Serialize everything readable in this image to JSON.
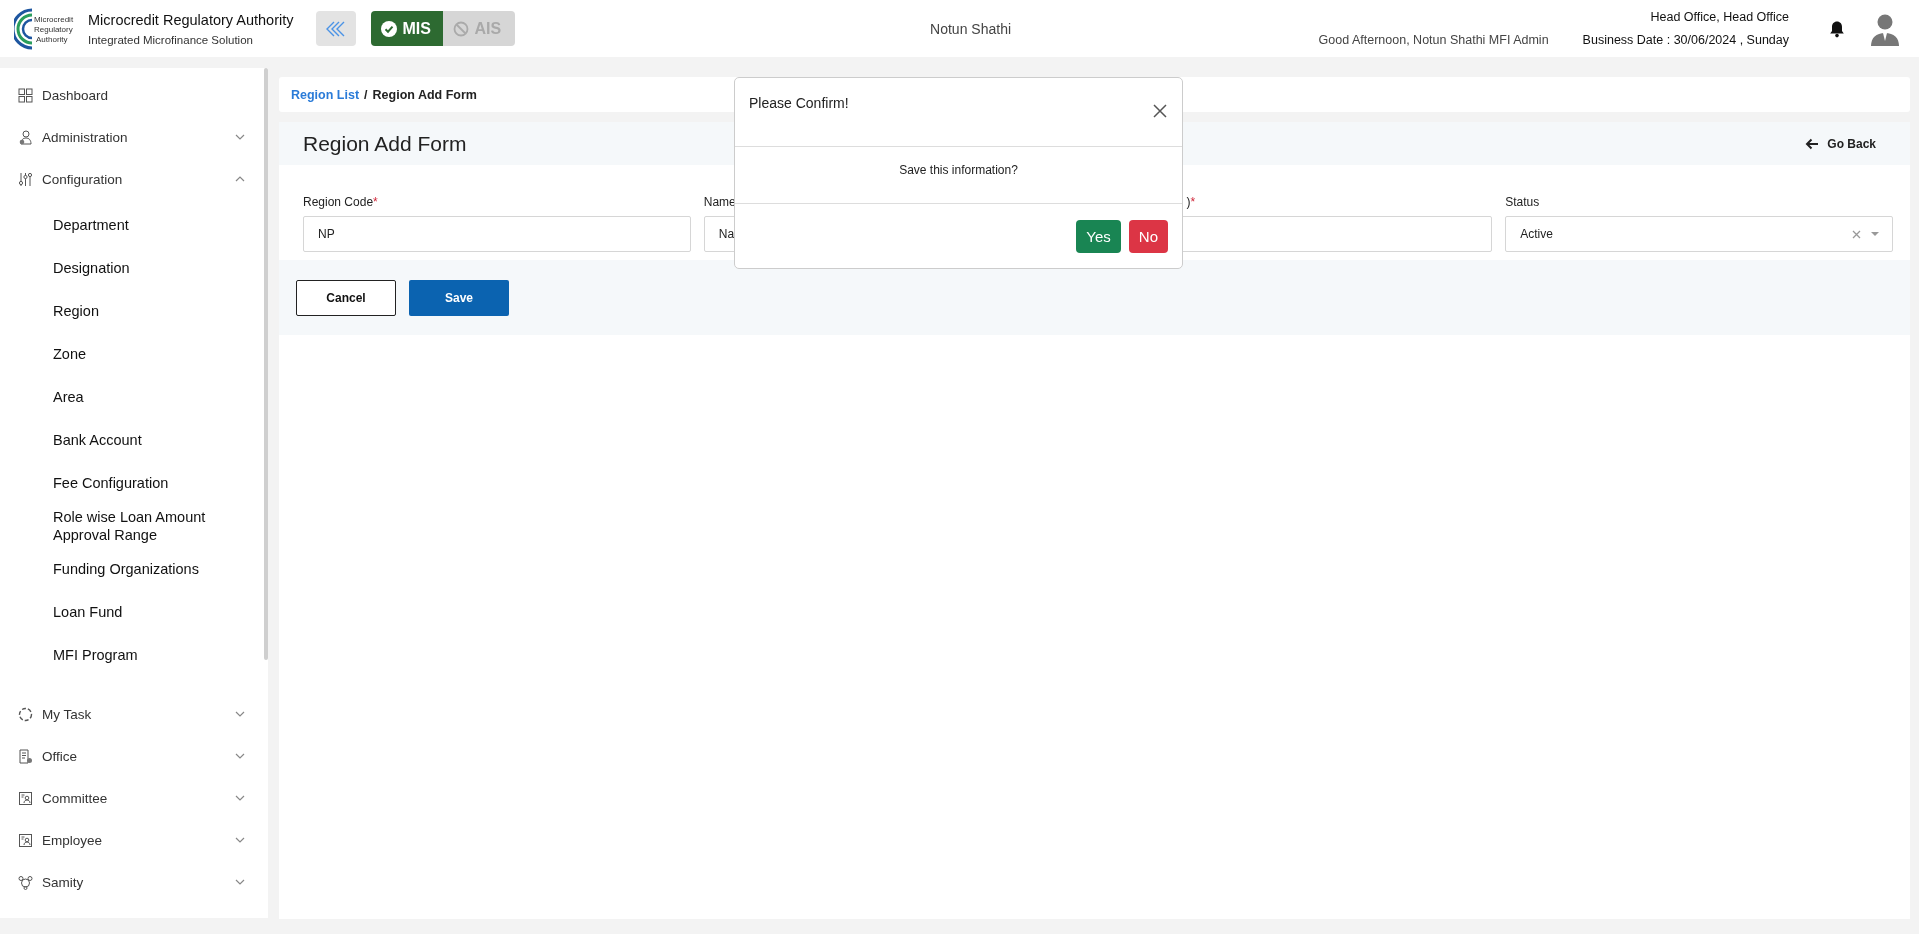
{
  "header": {
    "logo_text": [
      "Microcredit",
      "Regulatory",
      "Authority"
    ],
    "title": "Microcredit Regulatory Authority",
    "subtitle": "Integrated Microfinance Solution",
    "modes": [
      {
        "label": "MIS",
        "selected": true
      },
      {
        "label": "AIS",
        "selected": false
      }
    ],
    "organization": "Notun Shathi",
    "greeting": "Good Afternoon, Notun Shathi MFI Admin",
    "office": "Head Office, Head Office",
    "business_date": "Business Date : 30/06/2024 , Sunday"
  },
  "sidebar": {
    "items": [
      {
        "label": "Dashboard"
      },
      {
        "label": "Administration",
        "expanded": false
      },
      {
        "label": "Configuration",
        "expanded": true,
        "children": [
          {
            "label": "Department"
          },
          {
            "label": "Designation"
          },
          {
            "label": "Region"
          },
          {
            "label": "Zone"
          },
          {
            "label": "Area"
          },
          {
            "label": "Bank Account"
          },
          {
            "label": "Fee Configuration"
          },
          {
            "label": "Role wise Loan Amount Approval Range"
          },
          {
            "label": "Funding Organizations"
          },
          {
            "label": "Loan Fund"
          },
          {
            "label": "MFI Program"
          }
        ]
      },
      {
        "label": "My Task",
        "expanded": false
      },
      {
        "label": "Office",
        "expanded": false
      },
      {
        "label": "Committee",
        "expanded": false
      },
      {
        "label": "Employee",
        "expanded": false
      },
      {
        "label": "Samity",
        "expanded": false
      }
    ]
  },
  "breadcrumb": {
    "link": "Region List",
    "separator": "/",
    "current": "Region Add Form"
  },
  "form": {
    "title": "Region Add Form",
    "back": "Go Back",
    "fields": [
      {
        "label": "Region Code",
        "required_mark": "*",
        "value": "NP",
        "kind": "text"
      },
      {
        "label": "Name",
        "value": "Na",
        "kind": "text"
      },
      {
        "label": ")",
        "required_mark": "*",
        "kind": "text"
      },
      {
        "label": "Status",
        "value": "Active",
        "kind": "select"
      }
    ],
    "buttons": [
      {
        "label": "Cancel",
        "kind": "secondary"
      },
      {
        "label": "Save",
        "kind": "primary"
      }
    ]
  },
  "dialog": {
    "title": "Please Confirm!",
    "message": "Save this information?",
    "buttons": [
      {
        "label": "Yes",
        "kind": "confirm"
      },
      {
        "label": "No",
        "kind": "cancel"
      }
    ]
  }
}
